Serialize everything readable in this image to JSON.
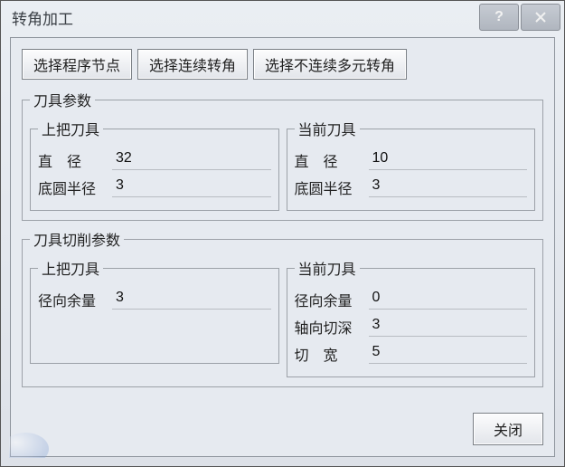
{
  "window": {
    "title": "转角加工"
  },
  "buttons": {
    "select_program_node": "选择程序节点",
    "select_continuous_corner": "选择连续转角",
    "select_discontinuous_multi_corner": "选择不连续多元转角",
    "close": "关闭"
  },
  "groups": {
    "tool_params": "刀具参数",
    "cutting_params": "刀具切削参数",
    "prev_tool": "上把刀具",
    "current_tool": "当前刀具"
  },
  "labels": {
    "diameter": "直　径",
    "bottom_radius": "底圆半径",
    "radial_allowance": "径向余量",
    "axial_depth": "轴向切深",
    "cut_width": "切　宽"
  },
  "tool_params": {
    "prev": {
      "diameter": "32",
      "bottom_radius": "3"
    },
    "current": {
      "diameter": "10",
      "bottom_radius": "3"
    }
  },
  "cutting_params": {
    "prev": {
      "radial_allowance": "3"
    },
    "current": {
      "radial_allowance": "0",
      "axial_depth": "3",
      "cut_width": "5"
    }
  }
}
